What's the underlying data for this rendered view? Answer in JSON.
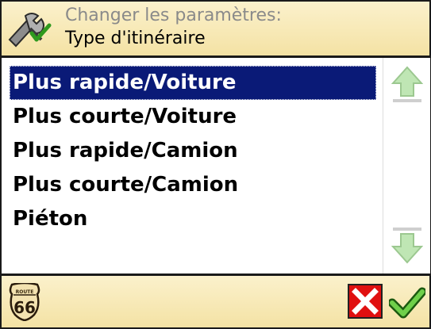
{
  "header": {
    "subtitle": "Changer les paramètres:",
    "title": "Type d'itinéraire",
    "icon": "settings-tools-icon"
  },
  "list": {
    "selected_index": 0,
    "items": [
      {
        "label": "Plus rapide/Voiture"
      },
      {
        "label": "Plus courte/Voiture"
      },
      {
        "label": "Plus rapide/Camion"
      },
      {
        "label": "Plus courte/Camion"
      },
      {
        "label": "Piéton"
      }
    ]
  },
  "scroll": {
    "up_icon": "arrow-up-icon",
    "down_icon": "arrow-down-icon"
  },
  "footer": {
    "route_badge": {
      "top": "ROUTE",
      "number": "66"
    },
    "cancel_icon": "close-icon",
    "ok_icon": "checkmark-icon"
  },
  "colors": {
    "header_bg": "#f4e2a4",
    "selection_bg": "#0a1a77",
    "cancel_red": "#e01010",
    "ok_green": "#3aa01e"
  }
}
